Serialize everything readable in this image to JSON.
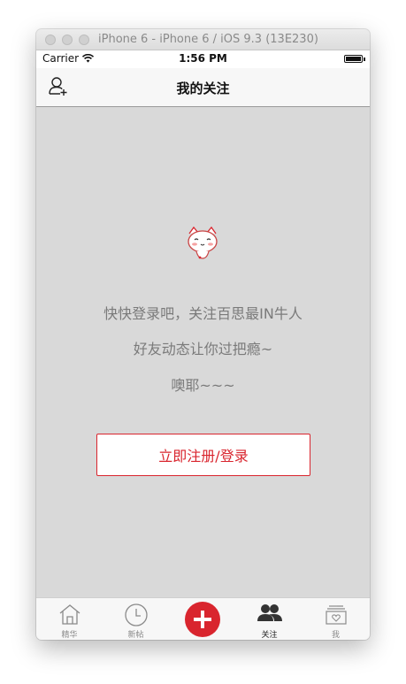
{
  "window": {
    "title": "iPhone 6 - iPhone 6 / iOS 9.3 (13E230)"
  },
  "statusbar": {
    "carrier": "Carrier",
    "time": "1:56 PM",
    "battery_level": 1.0
  },
  "navbar": {
    "title": "我的关注",
    "left_icon": "add-user-icon"
  },
  "empty_state": {
    "mascot_icon": "cat-mascot-icon",
    "line1": "快快登录吧，关注百思最IN牛人",
    "line2": "好友动态让你过把瘾~",
    "line3": "噢耶~~~",
    "button_label": "立即注册/登录"
  },
  "tabbar": {
    "items": [
      {
        "label": "精华",
        "icon": "home-icon",
        "active": false
      },
      {
        "label": "新帖",
        "icon": "clock-icon",
        "active": false
      },
      {
        "label": "",
        "icon": "plus-icon",
        "active": false
      },
      {
        "label": "关注",
        "icon": "people-icon",
        "active": true
      },
      {
        "label": "我",
        "icon": "profile-box-icon",
        "active": false
      }
    ]
  },
  "colors": {
    "accent": "#d9252e",
    "background": "#d9d9d9",
    "text_gray": "#7a7a7a"
  }
}
